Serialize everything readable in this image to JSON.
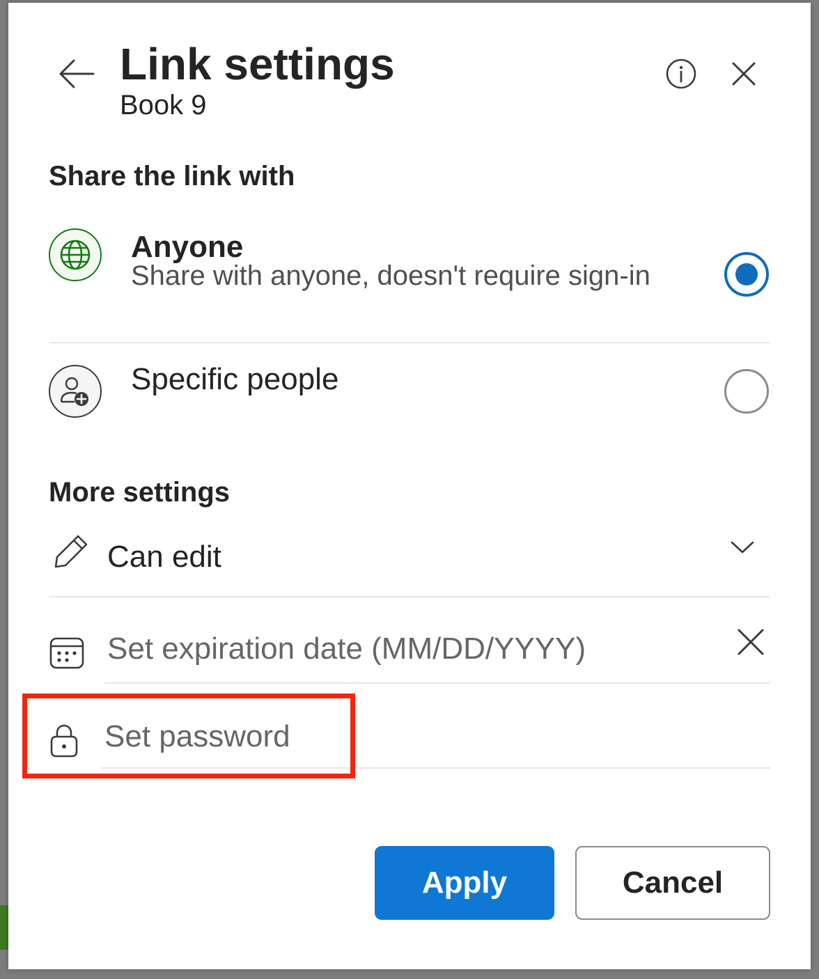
{
  "dialog": {
    "title": "Link settings",
    "subtitle": "Book 9",
    "back_icon": "arrow-left-icon",
    "info_icon": "info-icon",
    "close_icon": "close-icon"
  },
  "share_section": {
    "heading": "Share the link with",
    "options": [
      {
        "title": "Anyone",
        "description": "Share with anyone, doesn't require sign-in",
        "icon": "globe-icon",
        "selected": true
      },
      {
        "title": "Specific people",
        "icon": "person-add-icon",
        "selected": false
      }
    ]
  },
  "more_settings": {
    "heading": "More settings",
    "permission": {
      "label": "Can edit",
      "icon": "pencil-icon",
      "dropdown_icon": "chevron-down-icon"
    },
    "expiration": {
      "placeholder": "Set expiration date (MM/DD/YYYY)",
      "icon": "calendar-icon",
      "clear_icon": "close-icon"
    },
    "password": {
      "placeholder": "Set password",
      "icon": "lock-icon"
    }
  },
  "footer": {
    "apply_label": "Apply",
    "cancel_label": "Cancel"
  },
  "colors": {
    "primary": "#0f78d4",
    "radio_selected": "#0f6cbd",
    "globe_green": "#107c10",
    "highlight": "#f2260f"
  }
}
